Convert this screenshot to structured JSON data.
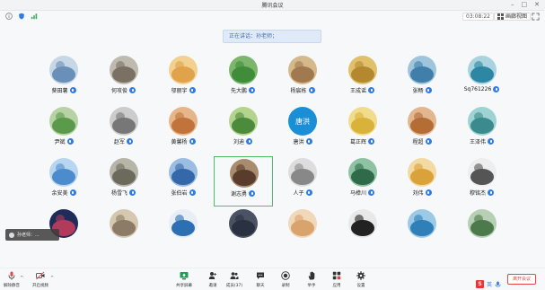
{
  "window": {
    "title": "腾讯会议"
  },
  "topbar": {
    "clock": "03:08:22",
    "view_label": "画廊视图",
    "speaking": "正在讲话：孙老师；"
  },
  "participants": [
    {
      "name": "葵田薯",
      "color": "#6a8fb8",
      "bg": "#c6d7e6"
    },
    {
      "name": "何攻俊",
      "color": "#7b7064",
      "bg": "#bfbab0"
    },
    {
      "name": "邬丽宇",
      "color": "#e0a24a",
      "bg": "#f2d08f"
    },
    {
      "name": "先大鹏",
      "color": "#3f8c3a",
      "bg": "#7cb66d"
    },
    {
      "name": "杨宸栋",
      "color": "#a07a4e",
      "bg": "#d6b98a"
    },
    {
      "name": "王成谣",
      "color": "#b4882e",
      "bg": "#e0c06b"
    },
    {
      "name": "张畅",
      "color": "#3f7fa9",
      "bg": "#9fc5dc"
    },
    {
      "name": "Sq761226",
      "color": "#2c86a4",
      "bg": "#a9d4df"
    },
    {
      "name": "尹斌",
      "color": "#5b9a4a",
      "bg": "#b7d3a6"
    },
    {
      "name": "赵军",
      "color": "#777777",
      "bg": "#cccccc"
    },
    {
      "name": "黄馨杨",
      "color": "#c0733b",
      "bg": "#e7b58a"
    },
    {
      "name": "刘迪",
      "color": "#4b8b3b",
      "bg": "#b4d48d"
    },
    {
      "name": "唐洪",
      "color": "#1a8fd6",
      "bg": "#1a8fd6",
      "initials": "唐洪"
    },
    {
      "name": "葛正辉",
      "color": "#d8b23a",
      "bg": "#f0dc8a"
    },
    {
      "name": "程超",
      "color": "#b36d35",
      "bg": "#e2b790"
    },
    {
      "name": "王泽伟",
      "color": "#3b8a8d",
      "bg": "#9fd2d3"
    },
    {
      "name": "余安美",
      "color": "#4d8ccc",
      "bg": "#b9d6f0"
    },
    {
      "name": "杨雪飞",
      "color": "#6c6a5d",
      "bg": "#b6b5a8"
    },
    {
      "name": "张伯岩",
      "color": "#3468a8",
      "bg": "#9cbde2"
    },
    {
      "name": "谢志勇",
      "color": "#5a3c2c",
      "bg": "#a98b6e"
    },
    {
      "name": "人子",
      "color": "#888888",
      "bg": "#dddddd"
    },
    {
      "name": "马樟川",
      "color": "#2f6b4a",
      "bg": "#8fc2a3"
    },
    {
      "name": "刘伟",
      "color": "#d9a23a",
      "bg": "#f3d9a2"
    },
    {
      "name": "穆铭杰",
      "color": "#555555",
      "bg": "#eeeeee"
    },
    {
      "name": "",
      "color": "#b23a5a",
      "bg": "#1f2c5a"
    },
    {
      "name": "",
      "color": "#8c7b66",
      "bg": "#d6c8b0"
    },
    {
      "name": "",
      "color": "#2d6fb3",
      "bg": "#e8eef6"
    },
    {
      "name": "",
      "color": "#2a3242",
      "bg": "#4a5264"
    },
    {
      "name": "",
      "color": "#d9a36e",
      "bg": "#f0d8b8"
    },
    {
      "name": "",
      "color": "#222222",
      "bg": "#e8e8e8"
    },
    {
      "name": "",
      "color": "#2f7fb8",
      "bg": "#9ccae6"
    },
    {
      "name": "",
      "color": "#4d7a4c",
      "bg": "#b7cfb2"
    }
  ],
  "active_index": 19,
  "toast": {
    "text": "孙老师：..."
  },
  "toolbar": {
    "items": [
      {
        "label": "解除静音",
        "icon": "mic-off-icon"
      },
      {
        "label": "开启视频",
        "icon": "video-off-icon"
      },
      {
        "label": "共享屏幕",
        "icon": "share-screen-icon"
      },
      {
        "label": "邀请",
        "icon": "invite-icon"
      },
      {
        "label": "成员(37)",
        "icon": "members-icon"
      },
      {
        "label": "聊天",
        "icon": "chat-icon"
      },
      {
        "label": "录制",
        "icon": "record-icon"
      },
      {
        "label": "举手",
        "icon": "raise-hand-icon"
      },
      {
        "label": "应用",
        "icon": "apps-icon"
      },
      {
        "label": "设置",
        "icon": "settings-icon"
      }
    ],
    "leave_label": "离开会议"
  },
  "ime": {
    "label": "英"
  },
  "colors": {
    "accent": "#2f7be8",
    "active_border": "#48c26b",
    "leave": "#e04848"
  }
}
